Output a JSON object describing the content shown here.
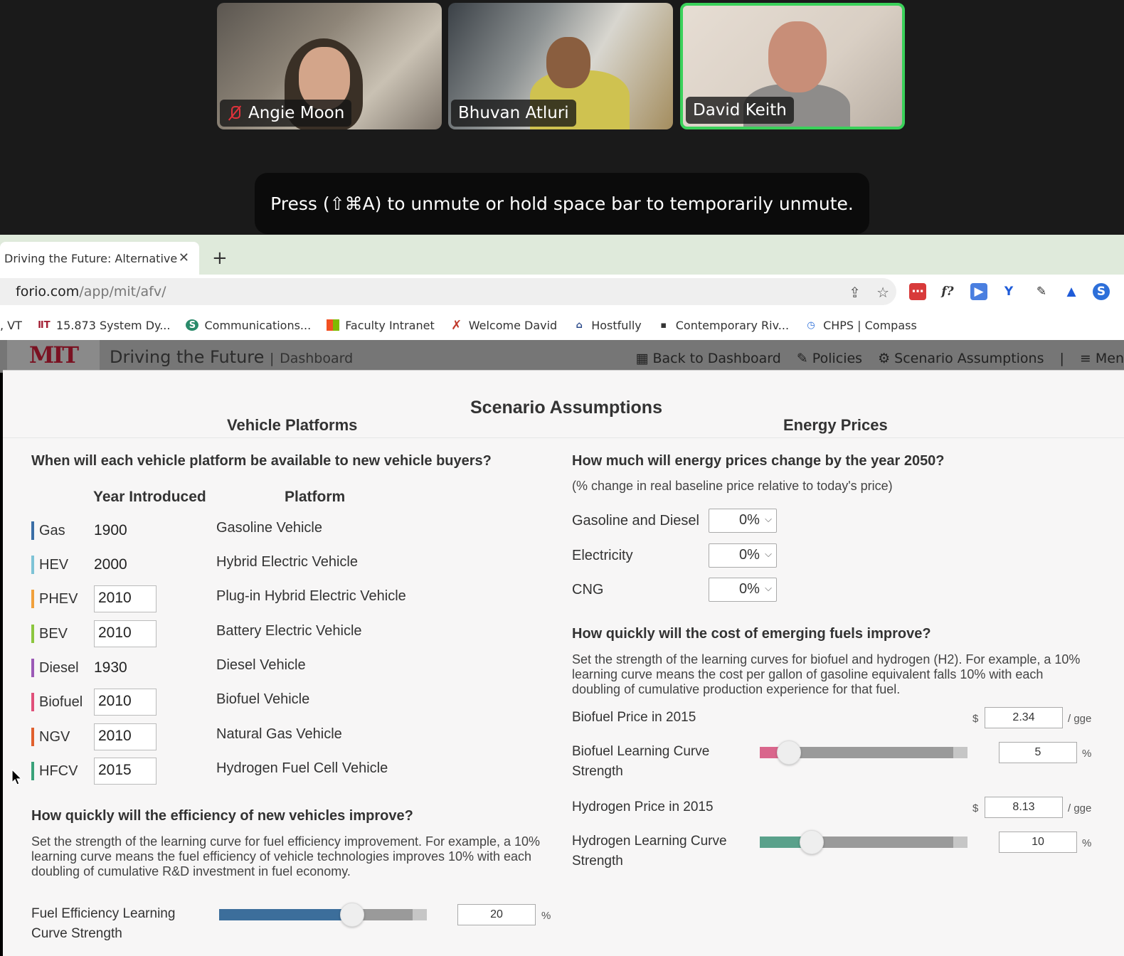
{
  "zoom": {
    "participants": [
      {
        "name": "Angie Moon",
        "muted": true
      },
      {
        "name": "Bhuvan Atluri",
        "muted": false
      },
      {
        "name": "David Keith",
        "muted": false,
        "active_speaker": true
      }
    ],
    "toast": "Press  (⇧⌘A) to unmute or hold space bar to temporarily unmute."
  },
  "browser": {
    "tab_title": "Driving the Future: Alternative",
    "tab_close": "✕",
    "new_tab": "+",
    "url_host": "forio.com",
    "url_path": "/app/mit/afv/",
    "bookmarks": [
      {
        "label": ", VT",
        "icon": ""
      },
      {
        "label": "15.873 System Dy...",
        "icon": "mit-icon"
      },
      {
        "label": "Communications...",
        "icon": "sharepoint-icon"
      },
      {
        "label": "Faculty Intranet",
        "icon": "windows-grid-icon"
      },
      {
        "label": "Welcome David",
        "icon": "x-icon"
      },
      {
        "label": "Hostfully",
        "icon": "hostfully-icon"
      },
      {
        "label": "Contemporary Riv...",
        "icon": "book-icon"
      },
      {
        "label": "CHPS | Compass",
        "icon": "timer-icon"
      }
    ]
  },
  "app": {
    "logo": "MIT",
    "title": "Driving the Future",
    "title_sep": "|",
    "subtitle": "Dashboard",
    "nav": {
      "back": "Back to Dashboard",
      "policies": "Policies",
      "scenario": "Scenario Assumptions",
      "sep": "|",
      "menu": "Men"
    }
  },
  "modal": {
    "title": "Scenario Assumptions",
    "left_heading": "Vehicle Platforms",
    "right_heading": "Energy Prices",
    "vehicle_question": "When will each vehicle platform be available to new vehicle buyers?",
    "col_year": "Year Introduced",
    "col_platform": "Platform",
    "vehicles": [
      {
        "code": "Gas",
        "year": "1900",
        "editable": false,
        "platform": "Gasoline Vehicle",
        "color": "#3b6ea6"
      },
      {
        "code": "HEV",
        "year": "2000",
        "editable": false,
        "platform": "Hybrid Electric Vehicle",
        "color": "#7ec3d6"
      },
      {
        "code": "PHEV",
        "year": "2010",
        "editable": true,
        "platform": "Plug-in Hybrid Electric Vehicle",
        "color": "#f0a03c"
      },
      {
        "code": "BEV",
        "year": "2010",
        "editable": true,
        "platform": "Battery Electric Vehicle",
        "color": "#8cc63f"
      },
      {
        "code": "Diesel",
        "year": "1930",
        "editable": false,
        "platform": "Diesel Vehicle",
        "color": "#9b59b6"
      },
      {
        "code": "Biofuel",
        "year": "2010",
        "editable": true,
        "platform": "Biofuel Vehicle",
        "color": "#e0507a"
      },
      {
        "code": "NGV",
        "year": "2010",
        "editable": true,
        "platform": "Natural Gas Vehicle",
        "color": "#e0602e"
      },
      {
        "code": "HFCV",
        "year": "2015",
        "editable": true,
        "platform": "Hydrogen Fuel Cell Vehicle",
        "color": "#3aa27a"
      }
    ],
    "efficiency_question": "How quickly will the efficiency of new vehicles improve?",
    "efficiency_text": "Set the strength of the learning curve for fuel efficiency improvement. For example, a 10% learning curve means the fuel efficiency of vehicle technologies improves 10% with each doubling of cumulative R&D investment in fuel economy.",
    "efficiency_label_1": "Fuel Efficiency Learning",
    "efficiency_label_2": "Curve Strength",
    "efficiency_value": "20",
    "efficiency_fraction": 0.64,
    "percent": "%",
    "energy_question": "How much will energy prices change by the year 2050?",
    "energy_sub": "(% change in real baseline price relative to today's price)",
    "energy_rows": [
      {
        "label": "Gasoline and Diesel",
        "value": "0%"
      },
      {
        "label": "Electricity",
        "value": "0%"
      },
      {
        "label": "CNG",
        "value": "0%"
      }
    ],
    "fuels_question": "How quickly will the cost of emerging fuels improve?",
    "fuels_text": "Set the strength of the learning curves for biofuel and hydrogen (H2). For example, a 10% learning curve means the cost per gallon of gasoline equivalent falls 10% with each doubling of cumulative production experience for that fuel.",
    "currency": "$",
    "per_gge": "/ gge",
    "biofuel_price_label": "Biofuel Price in 2015",
    "biofuel_price": "2.34",
    "biofuel_curve_label_1": "Biofuel Learning Curve",
    "biofuel_curve_label_2": "Strength",
    "biofuel_curve_value": "5",
    "biofuel_curve_fraction": 0.14,
    "hydrogen_price_label": "Hydrogen Price in 2015",
    "hydrogen_price": "8.13",
    "hydrogen_curve_label_1": "Hydrogen Learning Curve",
    "hydrogen_curve_label_2": "Strength",
    "hydrogen_curve_value": "10",
    "hydrogen_curve_fraction": 0.25,
    "colors": {
      "efficiency_fill": "#3c6e9b",
      "biofuel_fill": "#d9668c",
      "hydrogen_fill": "#5aa18b"
    }
  }
}
